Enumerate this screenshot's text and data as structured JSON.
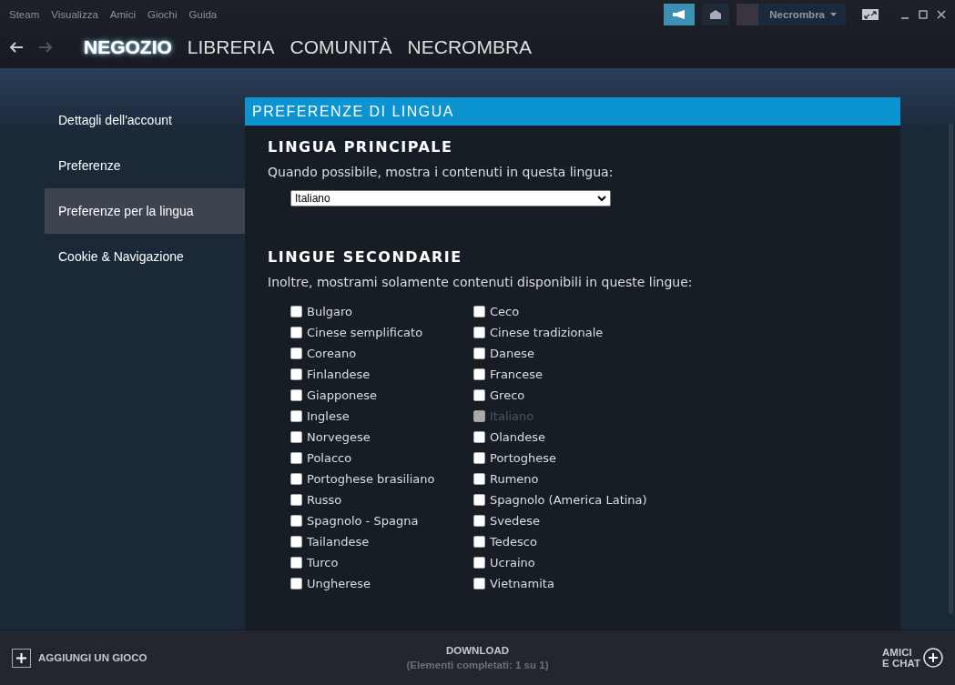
{
  "menu": [
    "Steam",
    "Visualizza",
    "Amici",
    "Giochi",
    "Guida"
  ],
  "account": {
    "name": "Necrombra"
  },
  "nav": {
    "tabs": [
      {
        "label": "NEGOZIO",
        "selected": true
      },
      {
        "label": "LIBRERIA",
        "selected": false
      },
      {
        "label": "COMUNITÀ",
        "selected": false
      },
      {
        "label": "NECROMBRA",
        "selected": false
      }
    ]
  },
  "sidebar": {
    "items": [
      {
        "label": "Dettagli dell'account",
        "selected": false
      },
      {
        "label": "Preferenze",
        "selected": false
      },
      {
        "label": "Preferenze per la lingua",
        "selected": true
      },
      {
        "label": "Cookie & Navigazione",
        "selected": false
      }
    ]
  },
  "panel": {
    "title": "PREFERENZE DI LINGUA",
    "primary": {
      "heading": "LINGUA PRINCIPALE",
      "description": "Quando possibile, mostra i contenuti in questa lingua:",
      "value": "Italiano"
    },
    "secondary": {
      "heading": "LINGUE SECONDARIE",
      "description": "Inoltre, mostrami solamente contenuti disponibili in queste lingue:",
      "languages": [
        {
          "label": "Bulgaro",
          "checked": false,
          "disabled": false
        },
        {
          "label": "Ceco",
          "checked": false,
          "disabled": false
        },
        {
          "label": "Cinese semplificato",
          "checked": false,
          "disabled": false
        },
        {
          "label": "Cinese tradizionale",
          "checked": false,
          "disabled": false
        },
        {
          "label": "Coreano",
          "checked": false,
          "disabled": false
        },
        {
          "label": "Danese",
          "checked": false,
          "disabled": false
        },
        {
          "label": "Finlandese",
          "checked": false,
          "disabled": false
        },
        {
          "label": "Francese",
          "checked": false,
          "disabled": false
        },
        {
          "label": "Giapponese",
          "checked": false,
          "disabled": false
        },
        {
          "label": "Greco",
          "checked": false,
          "disabled": false
        },
        {
          "label": "Inglese",
          "checked": false,
          "disabled": false
        },
        {
          "label": "Italiano",
          "checked": false,
          "disabled": true
        },
        {
          "label": "Norvegese",
          "checked": false,
          "disabled": false
        },
        {
          "label": "Olandese",
          "checked": false,
          "disabled": false
        },
        {
          "label": "Polacco",
          "checked": false,
          "disabled": false
        },
        {
          "label": "Portoghese",
          "checked": false,
          "disabled": false
        },
        {
          "label": "Portoghese brasiliano",
          "checked": false,
          "disabled": false
        },
        {
          "label": "Rumeno",
          "checked": false,
          "disabled": false
        },
        {
          "label": "Russo",
          "checked": false,
          "disabled": false
        },
        {
          "label": "Spagnolo (America Latina)",
          "checked": false,
          "disabled": false
        },
        {
          "label": "Spagnolo - Spagna",
          "checked": false,
          "disabled": false
        },
        {
          "label": "Svedese",
          "checked": false,
          "disabled": false
        },
        {
          "label": "Tailandese",
          "checked": false,
          "disabled": false
        },
        {
          "label": "Tedesco",
          "checked": false,
          "disabled": false
        },
        {
          "label": "Turco",
          "checked": false,
          "disabled": false
        },
        {
          "label": "Ucraino",
          "checked": false,
          "disabled": false
        },
        {
          "label": "Ungherese",
          "checked": false,
          "disabled": false
        },
        {
          "label": "Vietnamita",
          "checked": false,
          "disabled": false
        }
      ]
    }
  },
  "footer": {
    "add_game": "AGGIUNGI UN GIOCO",
    "download_title": "DOWNLOAD",
    "download_status": "(Elementi completati: 1 su 1)",
    "friends": [
      "AMICI",
      "E CHAT"
    ]
  }
}
